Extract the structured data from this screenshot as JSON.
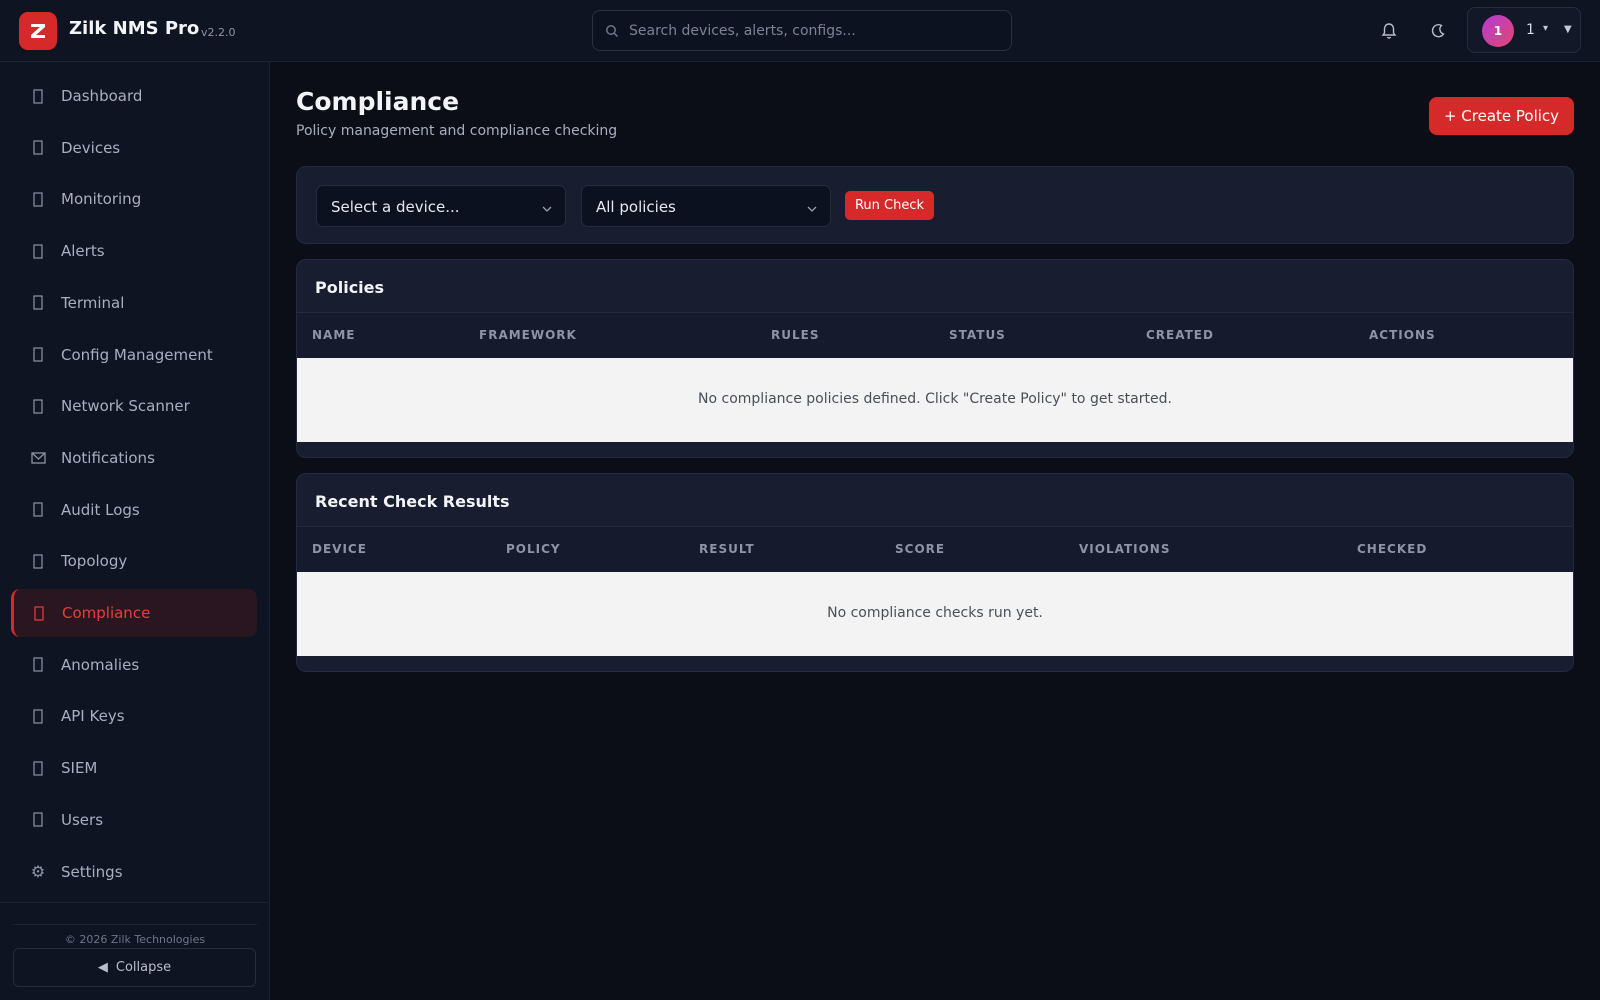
{
  "app": {
    "name": "Zilk NMS Pro",
    "version": "v2.2.0",
    "logo_icon": "zilk-logo-icon",
    "brand_color": "#d62a2a"
  },
  "topbar": {
    "search_placeholder": "Search devices, alerts, configs...",
    "user": {
      "avatar_initial": "1",
      "name": "1",
      "caret": "▾"
    }
  },
  "sidebar": {
    "items": [
      {
        "label": "Dashboard",
        "icon": "dashboard-icon"
      },
      {
        "label": "Devices",
        "icon": "devices-icon"
      },
      {
        "label": "Monitoring",
        "icon": "monitoring-icon"
      },
      {
        "label": "Alerts",
        "icon": "bell-icon"
      },
      {
        "label": "Terminal",
        "icon": "terminal-icon"
      },
      {
        "label": "Config Management",
        "icon": "config-icon"
      },
      {
        "label": "Network Scanner",
        "icon": "scanner-icon"
      },
      {
        "label": "Notifications",
        "icon": "envelope-icon"
      },
      {
        "label": "Audit Logs",
        "icon": "audit-icon"
      },
      {
        "label": "Topology",
        "icon": "topology-icon"
      },
      {
        "label": "Compliance",
        "icon": "shield-icon",
        "active": true
      },
      {
        "label": "Anomalies",
        "icon": "anomaly-icon"
      },
      {
        "label": "API Keys",
        "icon": "key-icon"
      },
      {
        "label": "SIEM",
        "icon": "siem-icon"
      },
      {
        "label": "Users",
        "icon": "users-icon"
      },
      {
        "label": "Settings",
        "icon": "gear-icon"
      }
    ],
    "copyright": "© 2026 Zilk Technologies",
    "collapse_label": "Collapse"
  },
  "page": {
    "title": "Compliance",
    "subtitle": "Policy management and compliance checking",
    "create_button": "+ Create Policy"
  },
  "filters": {
    "device_select": "Select a device...",
    "policy_select": "All policies",
    "run_button": "Run Check"
  },
  "policies": {
    "title": "Policies",
    "columns": [
      "NAME",
      "FRAMEWORK",
      "RULES",
      "STATUS",
      "CREATED",
      "ACTIONS"
    ],
    "empty": "No compliance policies defined. Click \"Create Policy\" to get started."
  },
  "results": {
    "title": "Recent Check Results",
    "columns": [
      "DEVICE",
      "POLICY",
      "RESULT",
      "SCORE",
      "VIOLATIONS",
      "CHECKED"
    ],
    "empty": "No compliance checks run yet."
  }
}
